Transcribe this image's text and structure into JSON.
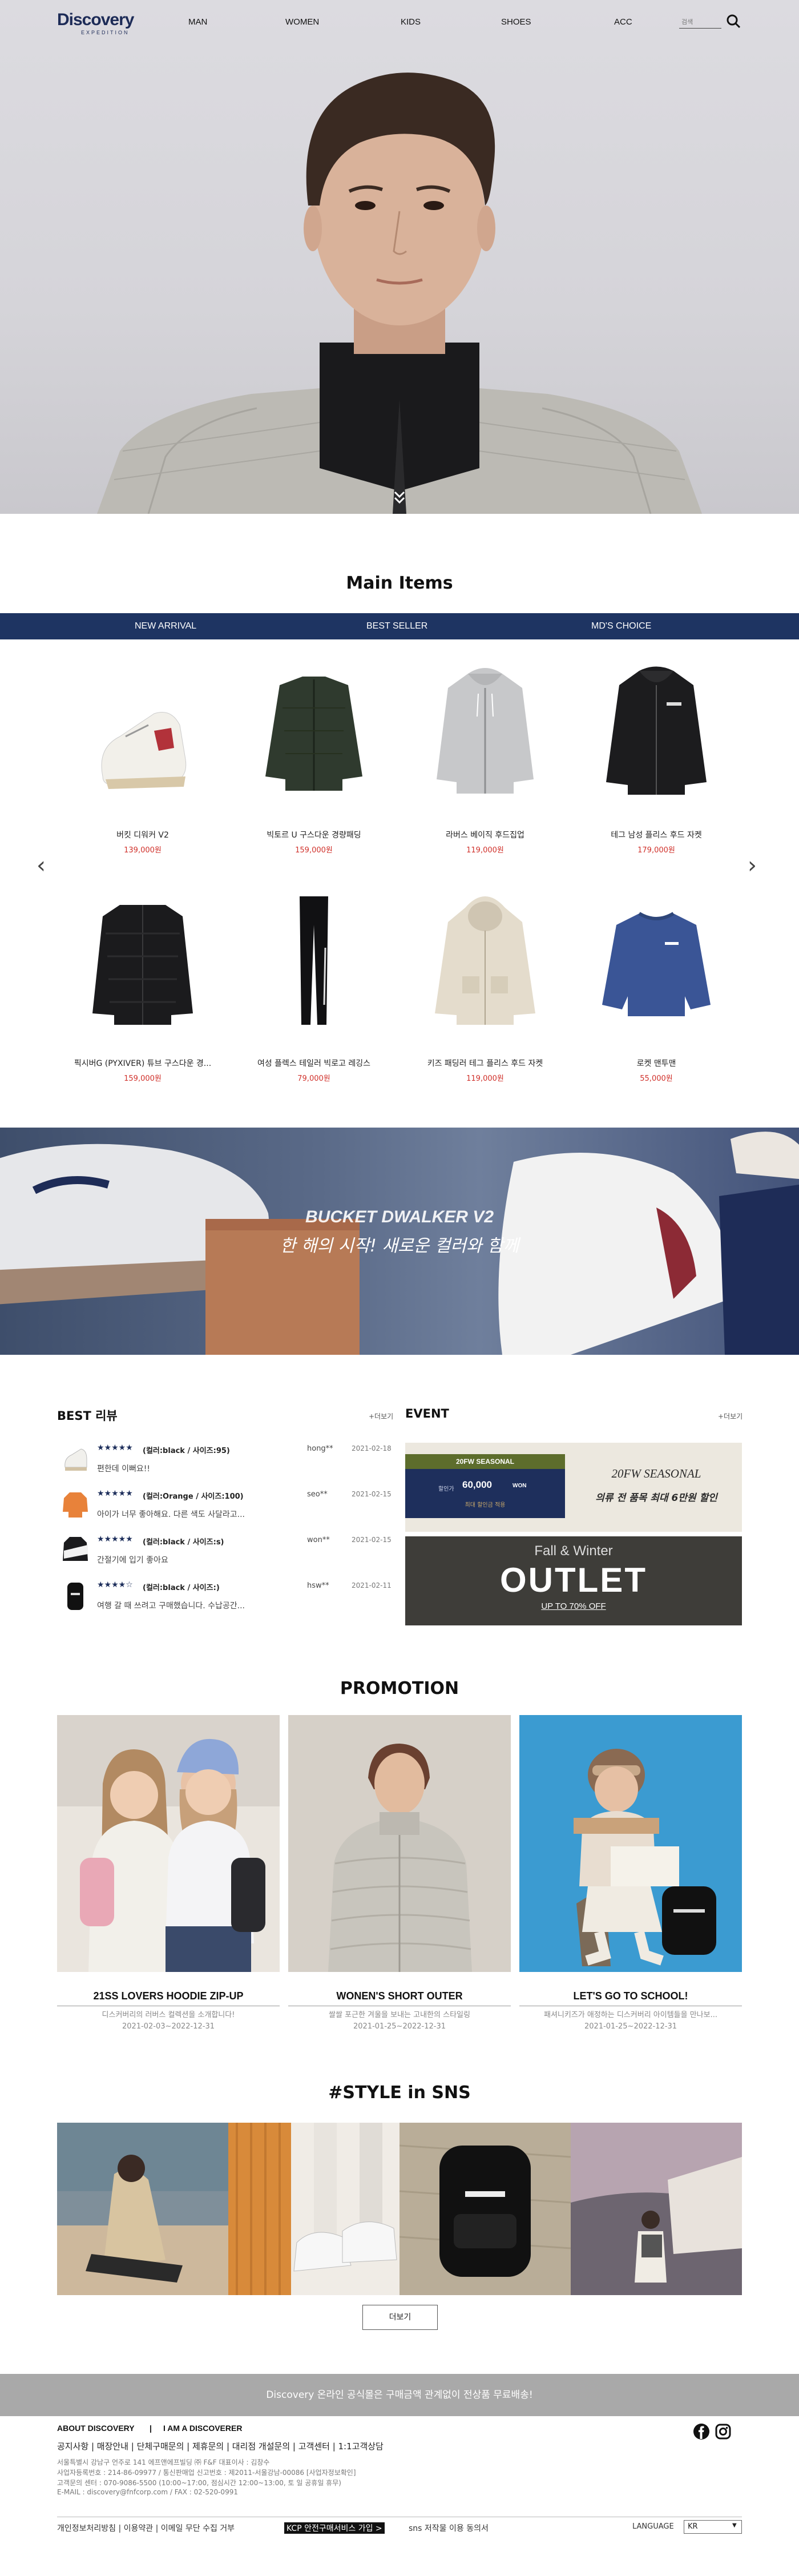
{
  "header": {
    "logo_top": "Discovery",
    "logo_bottom": "EXPEDITION",
    "nav": [
      "MAN",
      "WOMEN",
      "KIDS",
      "SHOES",
      "ACC"
    ],
    "search_placeholder": "검색"
  },
  "main_items": {
    "title": "Main Items",
    "tabs": [
      "NEW ARRIVAL",
      "BEST SELLER",
      "MD'S CHOICE"
    ],
    "products": [
      {
        "name": "버킷 디워커 V2",
        "price": "139,000원"
      },
      {
        "name": "빅토르 U 구스다운 경량패딩",
        "price": "159,000원"
      },
      {
        "name": "라버스 베이직 후드집업",
        "price": "119,000원"
      },
      {
        "name": "테그 남성 플리스 후드 자켓",
        "price": "179,000원"
      },
      {
        "name": "픽시버G (PYXIVER) 튜브 구스다운 경...",
        "price": "159,000원"
      },
      {
        "name": "여성 플렉스 테일러 빅로고 레깅스",
        "price": "79,000원"
      },
      {
        "name": "키즈 패딩러 테그 플리스 후드 자켓",
        "price": "119,000원"
      },
      {
        "name": "로켓 맨투맨",
        "price": "55,000원"
      }
    ]
  },
  "banner": {
    "line1": "BUCKET DWALKER V2",
    "line2": "한 해의 시작! 새로운 컬러와 함께"
  },
  "reviews": {
    "title": "BEST 리뷰",
    "more": "+더보기",
    "items": [
      {
        "stars": "★★★★★",
        "option": "(컬러:black / 사이즈:95)",
        "text": "편한데 이뻐요!!",
        "user": "hong**",
        "date": "2021-02-18"
      },
      {
        "stars": "★★★★★",
        "option": "(컬러:Orange / 사이즈:100)",
        "text": "아이가 너무 좋아해요. 다른 색도 사달라고...",
        "user": "seo**",
        "date": "2021-02-15"
      },
      {
        "stars": "★★★★★",
        "option": "(컬러:black / 사이즈:s)",
        "text": "간절기에 입기 좋아요",
        "user": "won**",
        "date": "2021-02-15"
      },
      {
        "stars": "★★★★☆",
        "option": "(컬러:black / 사이즈:)",
        "text": "여행 갈 때 쓰려고 구매했습니다. 수납공간...",
        "user": "hsw**",
        "date": "2021-02-11"
      }
    ]
  },
  "event": {
    "title": "EVENT",
    "more": "+더보기",
    "e1_badge": "20FW SEASONAL",
    "e1_price": "60,000",
    "e1_small": "할인가",
    "e1_unit": "WON",
    "e1_sub": "최대 할인금 적용",
    "e1_title": "20FW SEASONAL",
    "e1_desc": "의류 전 품목 최대 6만원 할인",
    "e2_line1": "Fall & Winter",
    "e2_line2": "OUTLET",
    "e2_line3": "UP TO 70% OFF"
  },
  "promotion": {
    "title": "PROMOTION",
    "items": [
      {
        "title": "21SS LOVERS HOODIE ZIP-UP",
        "desc": "디스커버리의 러버스 컬렉션을 소개합니다!",
        "date": "2021-02-03~2022-12-31"
      },
      {
        "title": "WONEN'S SHORT OUTER",
        "desc": "쌀쌀 포근한 겨울을 보내는 고내한의 스타일링",
        "date": "2021-01-25~2022-12-31"
      },
      {
        "title": "LET'S GO TO SCHOOL!",
        "desc": "패셔니키즈가 애정하는 디스커버리 아이템들을 만나보...",
        "date": "2021-01-25~2022-12-31"
      }
    ]
  },
  "sns": {
    "title": "#STYLE in SNS",
    "more_button": "더보기"
  },
  "footer": {
    "banner": "Discovery 온라인 공식몰은 구매금액 관계없이 전상품 무료배송!",
    "about": "ABOUT DISCOVERY",
    "sep": "|",
    "iam": "I AM A DISCOVERER",
    "nav": "공지사항   |   매장안내   |   단체구매문의   |   제휴문의   |   대리점 개설문의   |   고객센터   |   1:1고객상담",
    "info1": "서울특별시 강남구 언주로 141 에프앤에프빌딩 ㈜ F&F   대표이사 : 김창수",
    "info2": "사업자등록번호 : 214-86-09977 / 통신판매업 신고번호 : 제2011-서울강남-00086 [사업자정보확인]",
    "info3": "고객문의 센터 : 070-9086-5500 (10:00~17:00, 점심시간 12:00~13:00, 토 일 공휴일 휴무)",
    "info4": "E-MAIL : discovery@fnfcorp.com / FAX : 02-520-0991",
    "bottom_links": "개인정보처리방침   |   이용약관   |   이메일 무단 수집 거부",
    "kcp": "KCP 안전구매서비스 가입 >",
    "sns_copyright": "sns 저작물 이용 동의서",
    "language_label": "LANGUAGE",
    "language_value": "KR"
  }
}
